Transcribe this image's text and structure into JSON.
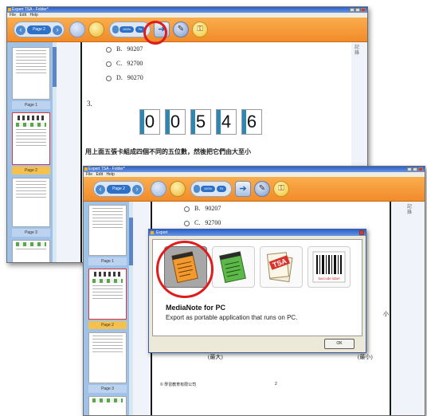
{
  "back_window": {
    "title": "Expert TSA - Folder*",
    "menu": [
      "File",
      "Edit",
      "Help"
    ],
    "toolbar": {
      "page_nav_label": "Page 2",
      "zoom_level": "100%",
      "zoom_pct": "Fit"
    },
    "sidebar": {
      "page_labels": [
        "Page 1",
        "Page 2",
        "Page 3"
      ]
    },
    "content": {
      "options": [
        {
          "letter": "B.",
          "value": "90207"
        },
        {
          "letter": "C.",
          "value": "92700"
        },
        {
          "letter": "D.",
          "value": "90270"
        }
      ],
      "question_number": "3.",
      "digit_cards": [
        "0",
        "0",
        "5",
        "4",
        "6"
      ],
      "question_text": "用上面五張卡組成四個不同的五位數，然後把它們由大至小",
      "margin_text": "小",
      "side_note": "記錄"
    }
  },
  "front_window": {
    "title": "Expert TSA - Folder*",
    "menu": [
      "File",
      "Edit",
      "Help"
    ],
    "toolbar": {
      "page_nav_label": "Page 2",
      "zoom_level": "100%",
      "zoom_pct": "Fit"
    },
    "sidebar": {
      "page_labels": [
        "Page 1",
        "Page 2",
        "Page 3"
      ]
    },
    "content": {
      "options": [
        {
          "letter": "B.",
          "value": "90207"
        },
        {
          "letter": "C.",
          "value": "92700"
        }
      ],
      "side_char": "小",
      "bracket_left": "(最大)",
      "bracket_right": "(最小)",
      "footer_copyright": "© 學習教育有限公司",
      "footer_page": "2",
      "side_note": "記錄"
    }
  },
  "export_dialog": {
    "title": "Export",
    "options": [
      {
        "name": "MediaNote for PC",
        "icon": "notepad-orange-icon"
      },
      {
        "name": "",
        "icon": "notepad-green-icon"
      },
      {
        "name": "",
        "icon": "tsa-stamp-icon"
      },
      {
        "name": "",
        "icon": "barcode-label-icon",
        "caption": "barcode label"
      }
    ],
    "selected_title": "MediaNote for PC",
    "selected_description": "Export as portable application that runs on PC.",
    "ok_label": "OK"
  },
  "colors": {
    "toolbar_orange": "#f39a38",
    "sidebar_blue": "#9fc2e8",
    "highlight_red": "#e01b1b",
    "selected_page_label": "#f6c04d"
  }
}
